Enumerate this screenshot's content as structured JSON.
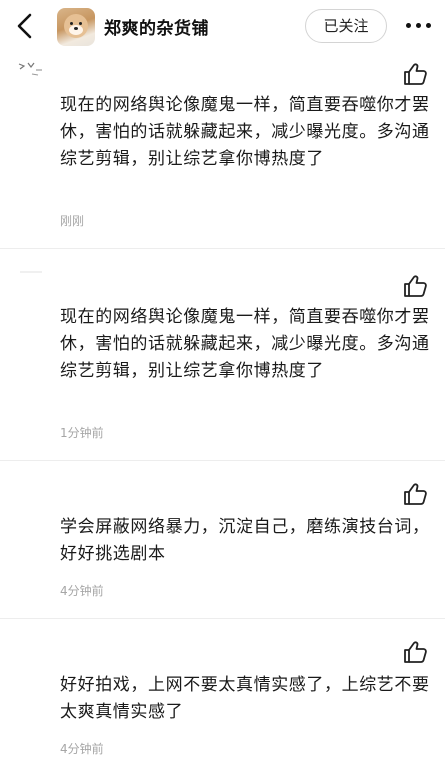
{
  "header": {
    "title": "郑爽的杂货铺",
    "follow_label": "已关注"
  },
  "comments": [
    {
      "text": "现在的网络舆论像魔鬼一样，简直要吞噬你才罢休，害怕的话就躲藏起来，减少曝光度。多沟通综艺剪辑，别让综艺拿你博热度了",
      "time": "刚刚"
    },
    {
      "text": "现在的网络舆论像魔鬼一样，简直要吞噬你才罢休，害怕的话就躲藏起来，减少曝光度。多沟通综艺剪辑，别让综艺拿你博热度了",
      "time": "1分钟前"
    },
    {
      "text": "学会屏蔽网络暴力，沉淀自己，磨练演技台词，好好挑选剧本",
      "time": "4分钟前"
    },
    {
      "text": "好好拍戏，上网不要太真情实感了，上综艺不要太爽真情实感了",
      "time": "4分钟前"
    }
  ],
  "icons": {
    "back": "chevron-left-icon",
    "more": "more-dots-icon",
    "like": "thumbs-up-icon"
  }
}
